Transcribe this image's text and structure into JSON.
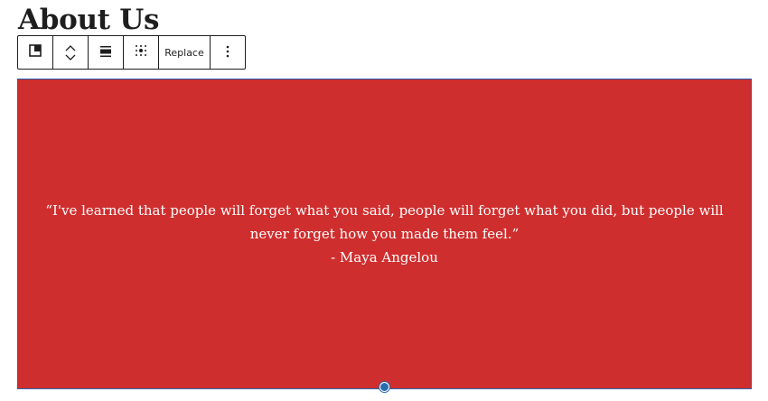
{
  "page": {
    "title": "About Us"
  },
  "toolbar": {
    "buttons": [
      {
        "name": "block-type",
        "icon": "cover-block-icon"
      },
      {
        "name": "move",
        "icon": "chevron-up-down-icon"
      },
      {
        "name": "align",
        "icon": "align-wide-icon"
      },
      {
        "name": "content-position",
        "icon": "position-grid-icon"
      },
      {
        "name": "replace",
        "label": "Replace"
      },
      {
        "name": "more-options",
        "icon": "vertical-ellipsis-icon"
      }
    ],
    "replace_label": "Replace"
  },
  "cover": {
    "background_color": "#cf2e2e",
    "quote": "“I've learned that people will forget what you said, people will forget what you did, but people will never forget how you made them feel.”",
    "attribution": "- Maya Angelou",
    "text_color": "#ffffff"
  },
  "colors": {
    "selection_accent": "#2b6cb0",
    "toolbar_border": "#1e1e1e"
  }
}
